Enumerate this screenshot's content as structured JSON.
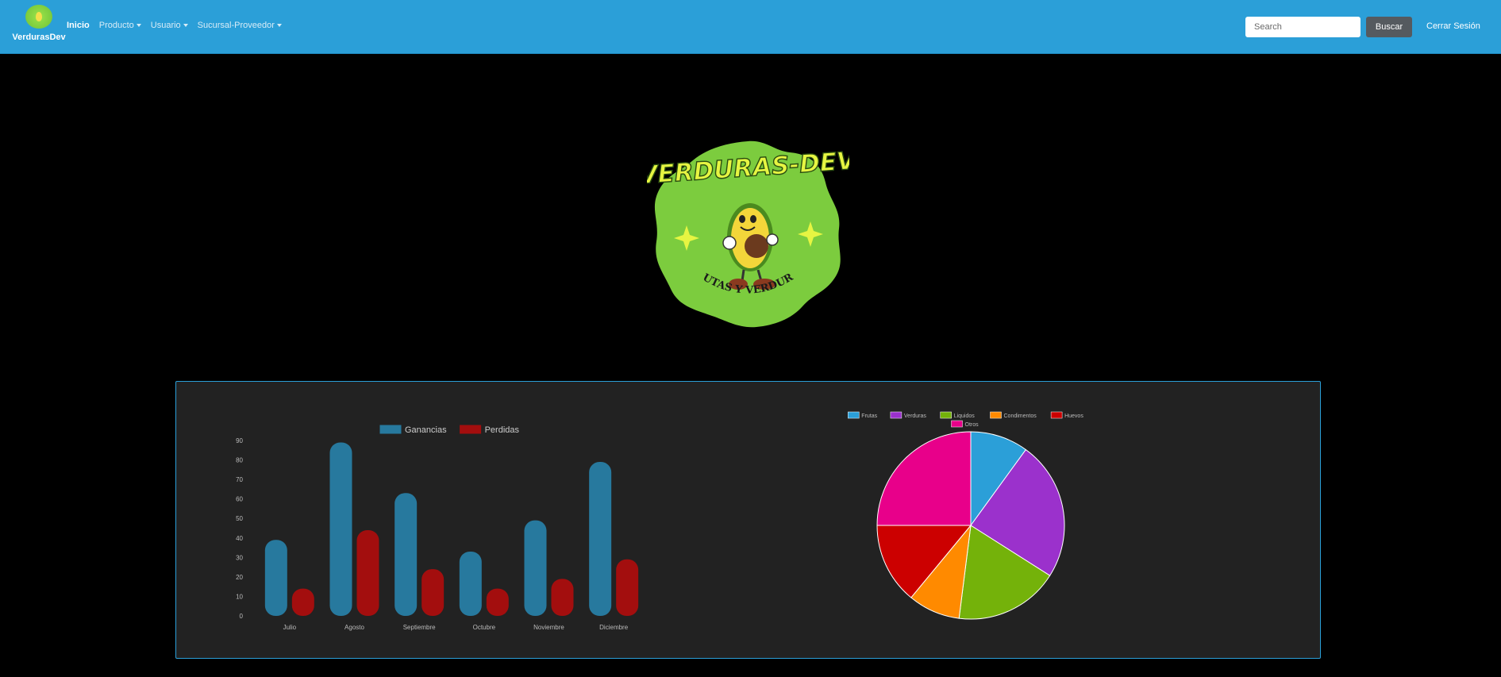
{
  "navbar": {
    "brand": "VerdurasDev",
    "links": [
      {
        "label": "Inicio",
        "active": true,
        "dropdown": false
      },
      {
        "label": "Producto",
        "active": false,
        "dropdown": true
      },
      {
        "label": "Usuario",
        "active": false,
        "dropdown": true
      },
      {
        "label": "Sucursal-Proveedor",
        "active": false,
        "dropdown": true
      }
    ],
    "search_placeholder": "Search",
    "search_button": "Buscar",
    "logout": "Cerrar Sesión"
  },
  "hero_logo": {
    "title": "VERDURAS-DEV",
    "subtitle": "FRUTAS Y VERDURAS"
  },
  "colors": {
    "navbar": "#2b9fd8",
    "panel": "#222222",
    "ganancias": "#27799e",
    "perdidas": "#a30e0e"
  },
  "chart_data": [
    {
      "type": "bar",
      "categories": [
        "Julio",
        "Agosto",
        "Septiembre",
        "Octubre",
        "Noviembre",
        "Diciembre"
      ],
      "series": [
        {
          "name": "Ganancias",
          "color": "#27799e",
          "values": [
            39,
            89,
            63,
            33,
            49,
            79
          ]
        },
        {
          "name": "Perdidas",
          "color": "#a30e0e",
          "values": [
            14,
            44,
            24,
            14,
            19,
            29
          ]
        }
      ],
      "ylim": [
        0,
        90
      ],
      "yticks": [
        "0",
        "10",
        "20",
        "30",
        "40",
        "50",
        "60",
        "70",
        "80",
        "90"
      ],
      "legend": "top"
    },
    {
      "type": "pie",
      "labels": [
        "Frutas",
        "Verduras",
        "Liquidos",
        "Condimentos",
        "Huevos",
        "Otros"
      ],
      "values": [
        10,
        24,
        18,
        9,
        14,
        25
      ],
      "colors": [
        "#2b9fd8",
        "#9b31cc",
        "#74b20a",
        "#ff8a00",
        "#cc0000",
        "#e8008a"
      ],
      "legend": "top"
    }
  ]
}
